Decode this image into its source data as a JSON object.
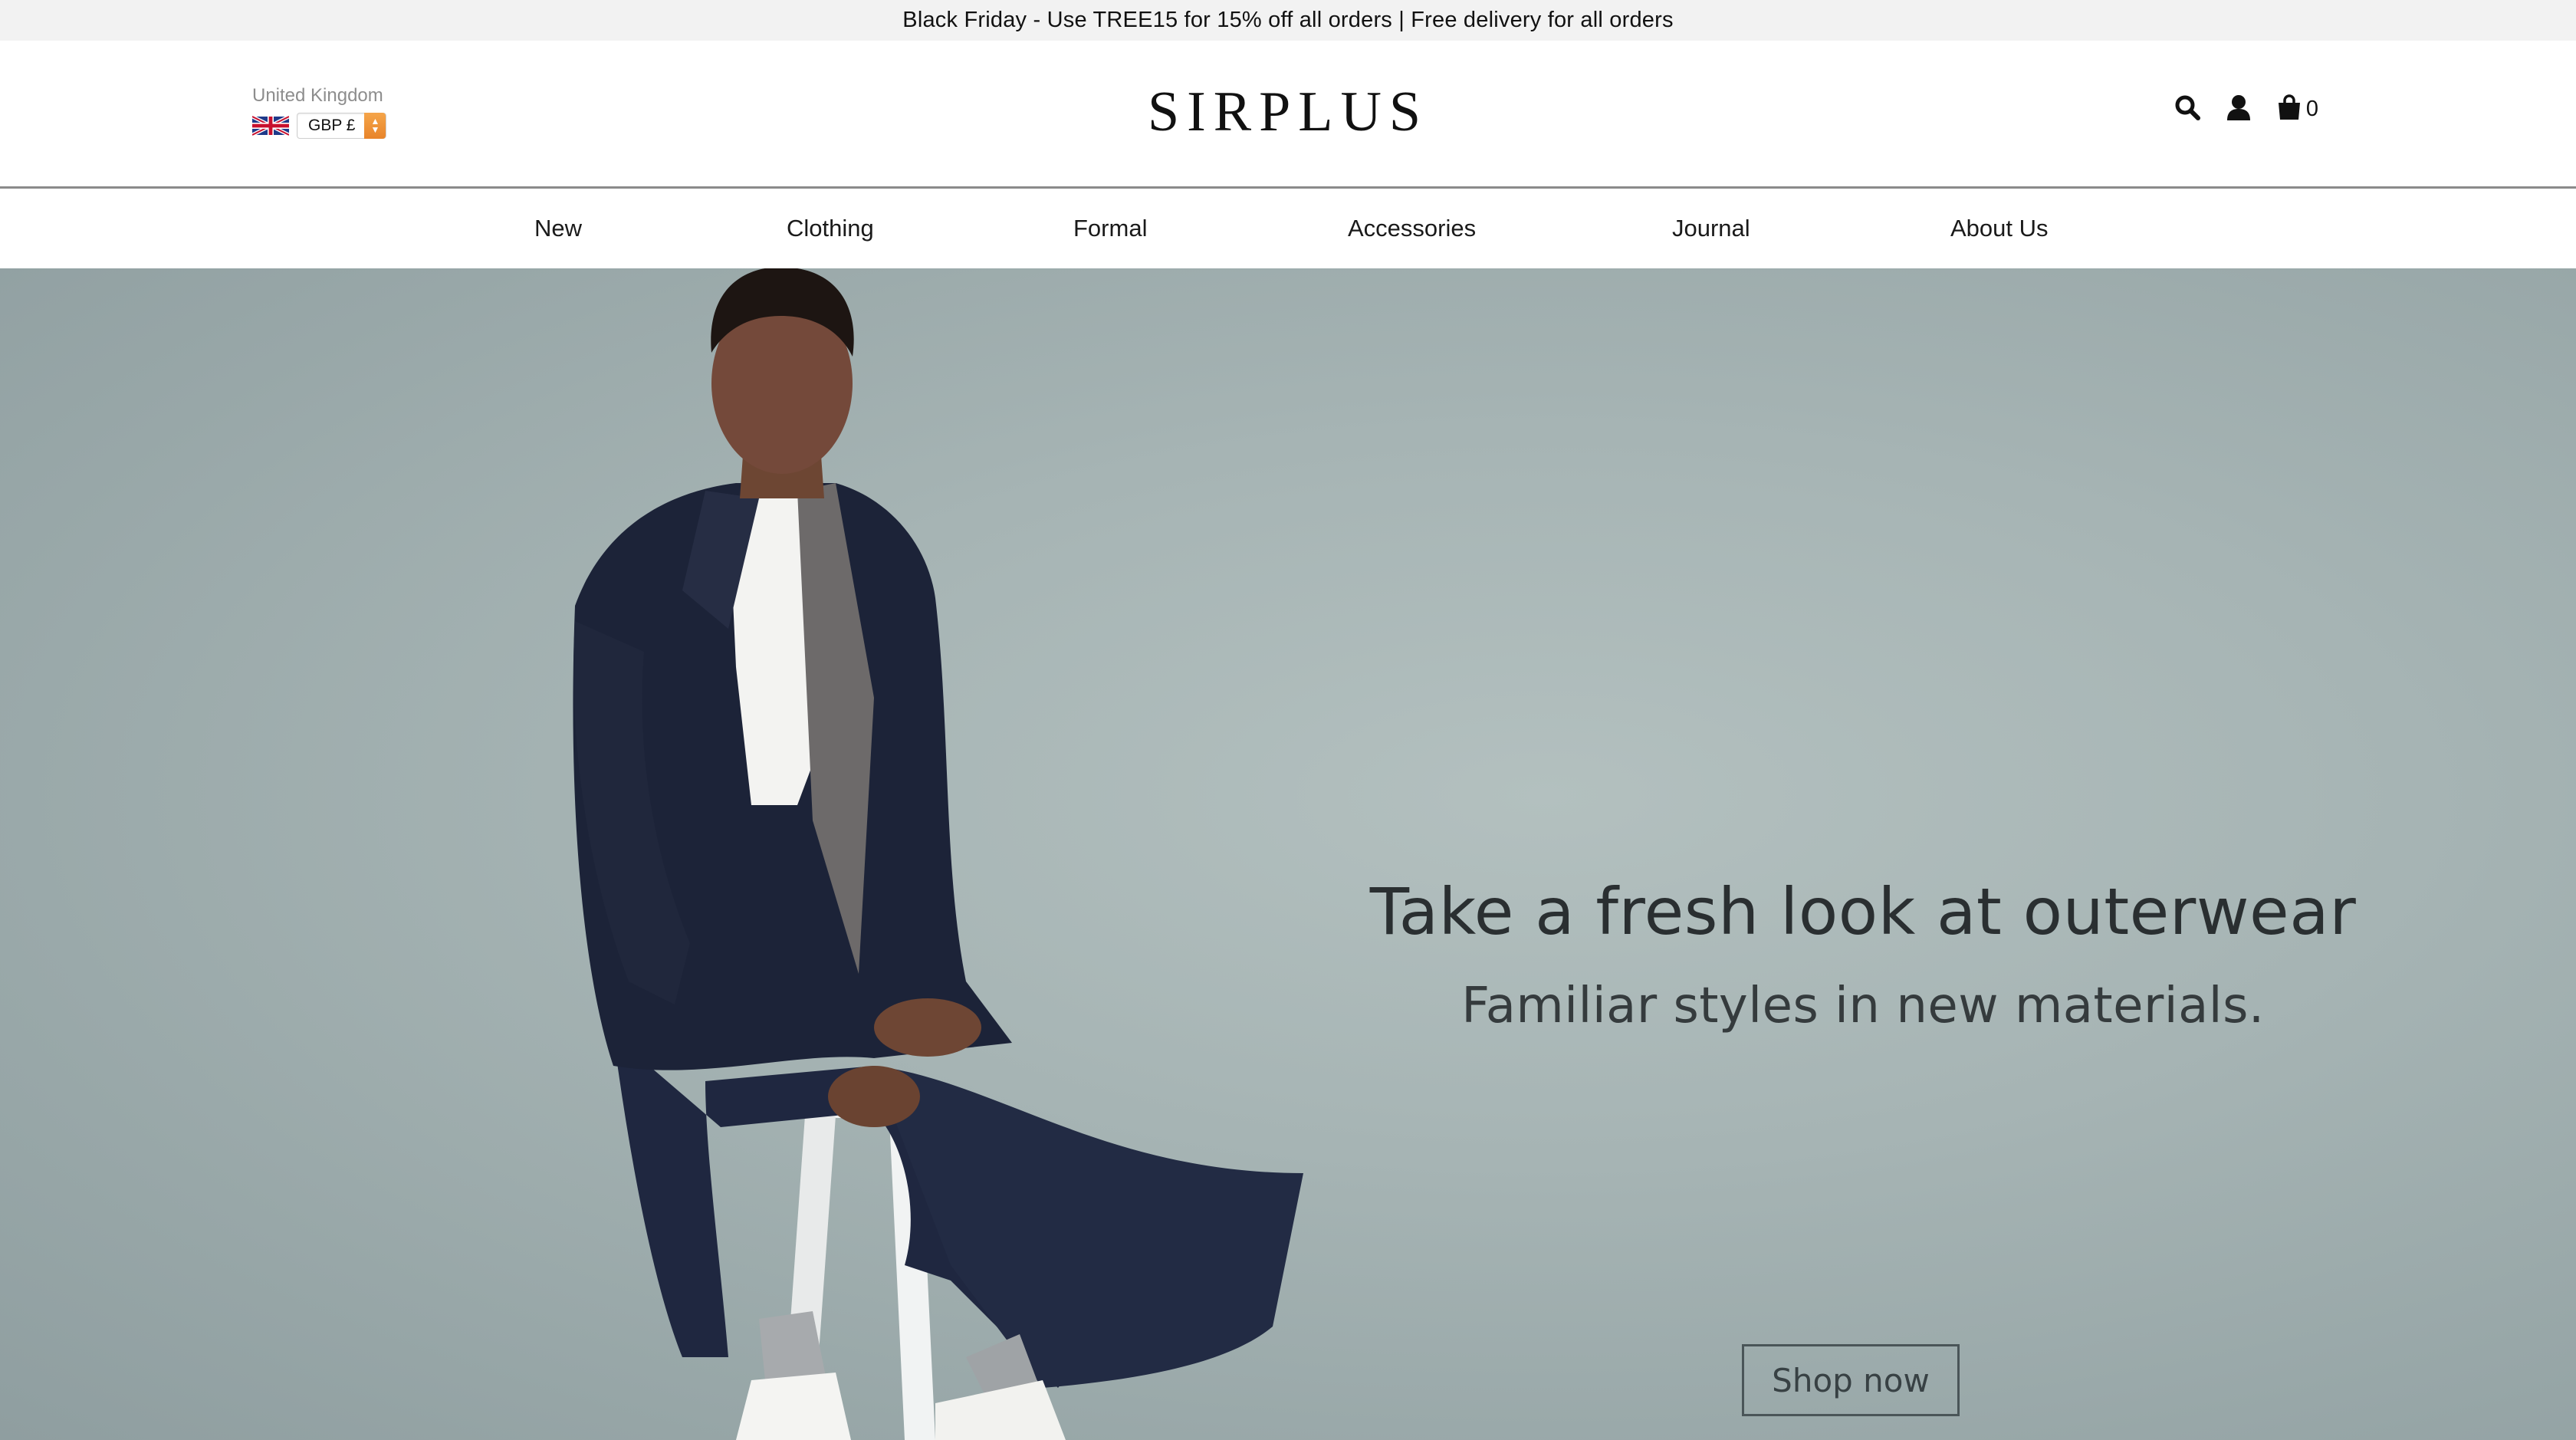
{
  "announcement": {
    "text": "Black Friday - Use TREE15 for 15% off all orders | Free delivery for all orders"
  },
  "header": {
    "region_label": "United Kingdom",
    "currency": "GBP £",
    "logo": "SIRPLUS",
    "icons": [
      "search-icon",
      "account-icon",
      "bag-icon"
    ],
    "cart_count": "0",
    "accent_color": "#f0922f"
  },
  "nav": {
    "items": [
      {
        "label": "New"
      },
      {
        "label": "Clothing"
      },
      {
        "label": "Formal"
      },
      {
        "label": "Accessories"
      },
      {
        "label": "Journal"
      },
      {
        "label": "About Us"
      }
    ]
  },
  "hero": {
    "title": "Take a fresh look at outerwear",
    "subtitle": "Familiar styles in new materials.",
    "cta_label": "Shop now",
    "background_color": "#a6b4b4"
  }
}
